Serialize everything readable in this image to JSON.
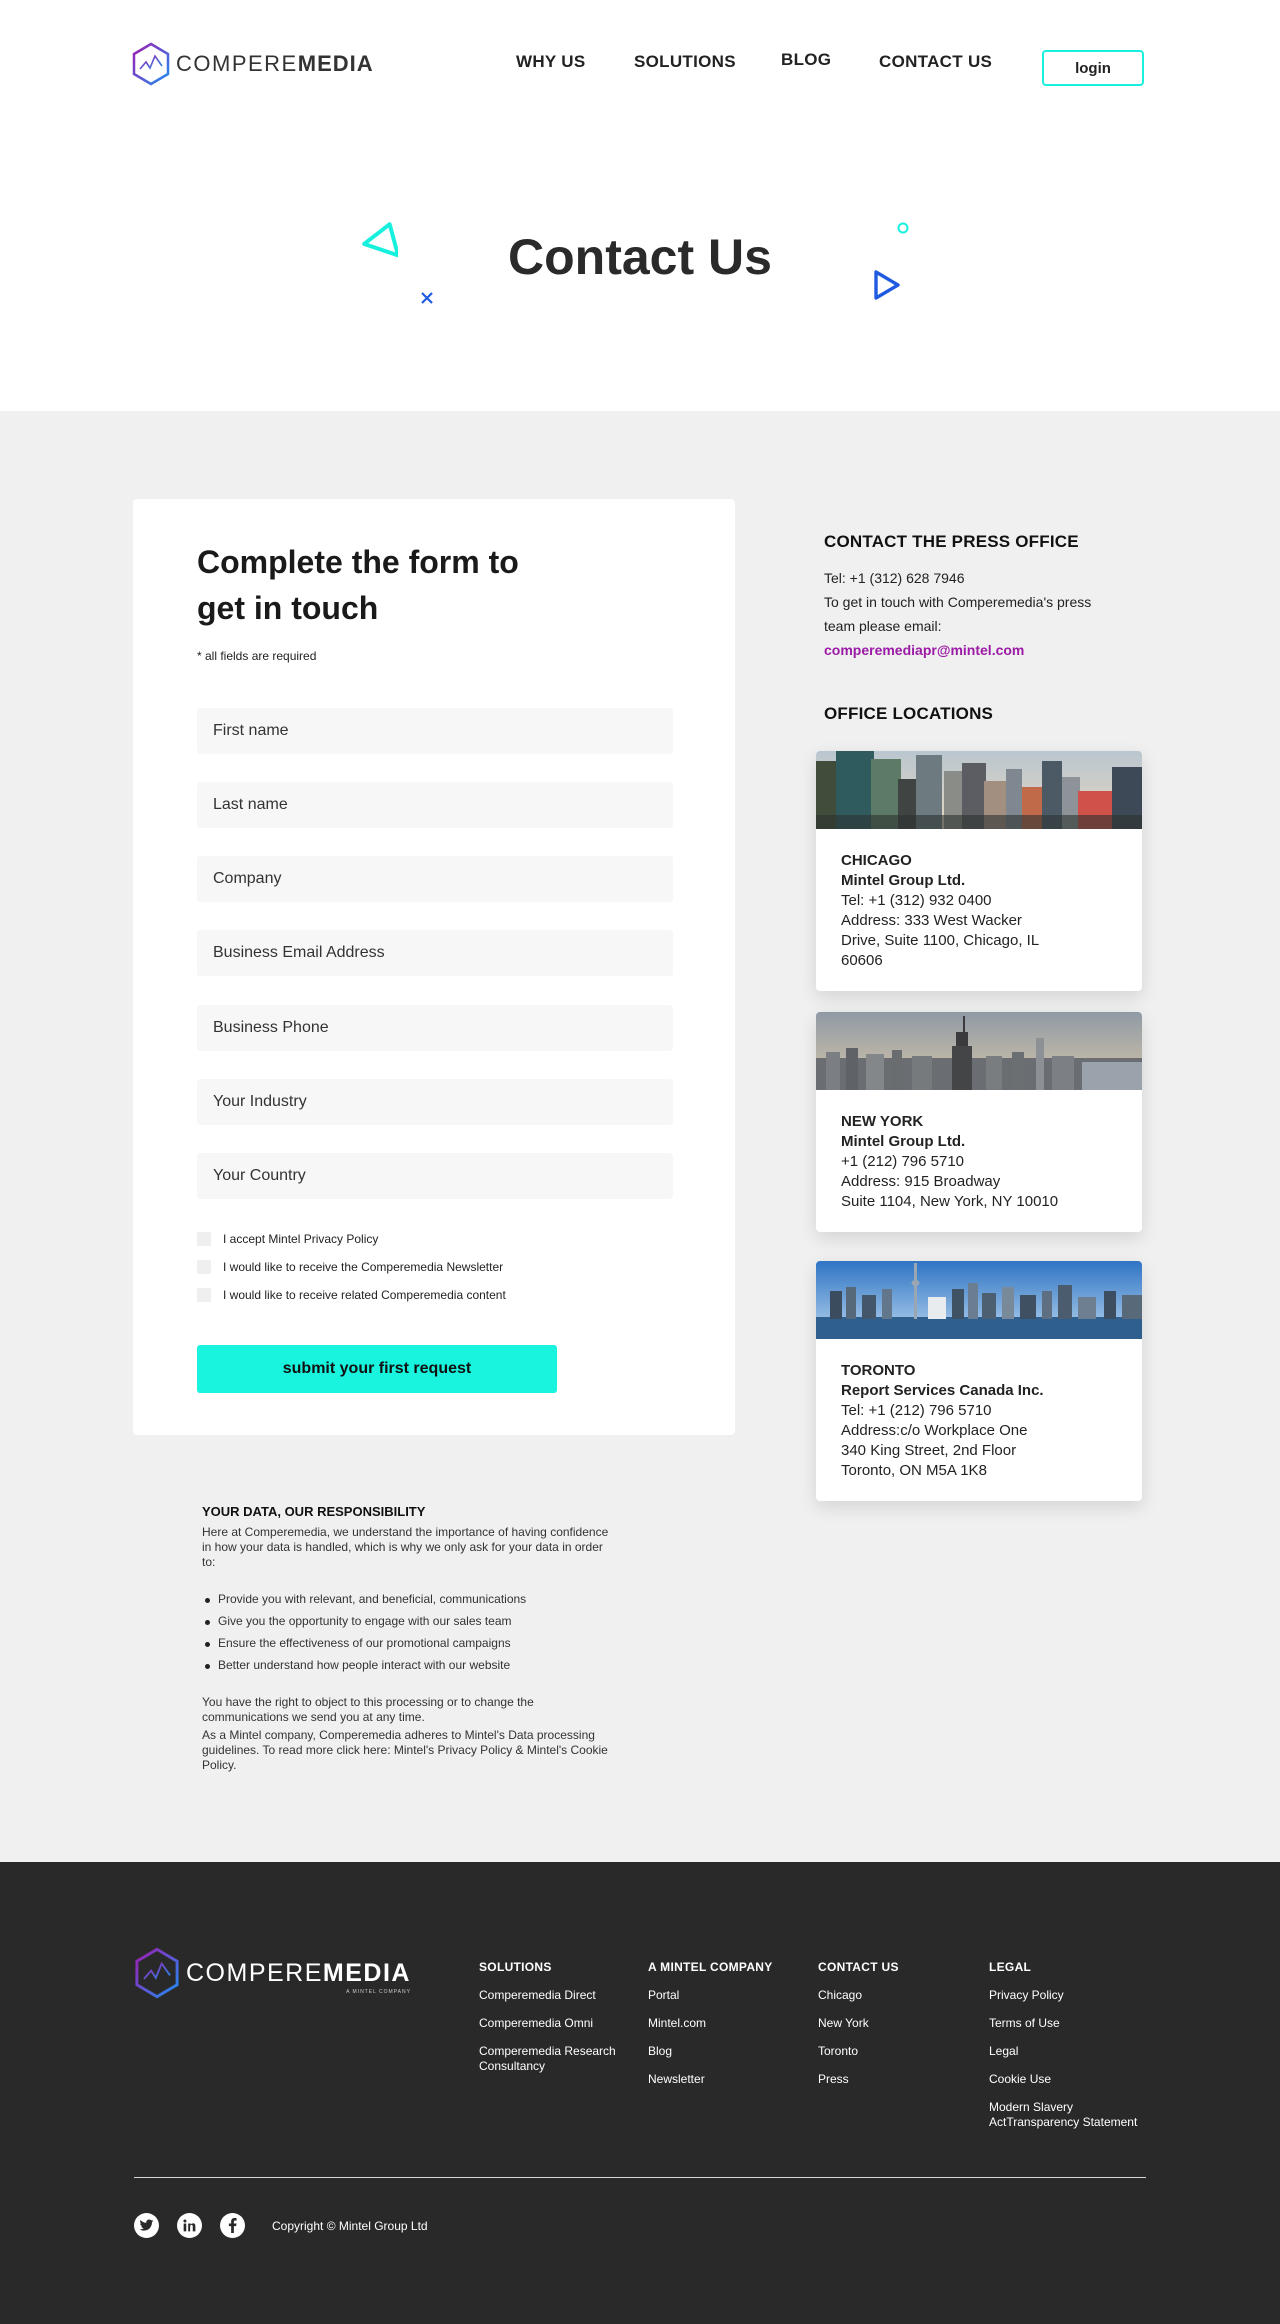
{
  "header": {
    "logo": {
      "word_light": "COMPERE",
      "word_bold": "MEDIA"
    },
    "nav": [
      {
        "label": "WHY US"
      },
      {
        "label": "SOLUTIONS"
      },
      {
        "label": "BLOG"
      },
      {
        "label": "CONTACT US"
      }
    ],
    "login_label": "login"
  },
  "hero": {
    "title": "Contact Us"
  },
  "form": {
    "title": "Complete the form to get in touch",
    "required_note": "* all fields are required",
    "fields": [
      {
        "placeholder": "First name",
        "value": ""
      },
      {
        "placeholder": "Last name",
        "value": ""
      },
      {
        "placeholder": "Company",
        "value": ""
      },
      {
        "placeholder": "Business Email Address",
        "value": ""
      },
      {
        "placeholder": "Business Phone",
        "value": ""
      },
      {
        "placeholder": "Your Industry",
        "value": ""
      },
      {
        "placeholder": "Your Country",
        "value": ""
      }
    ],
    "checkboxes": [
      {
        "label": "I accept Mintel Privacy Policy",
        "checked": false
      },
      {
        "label": "I would like to receive the Comperemedia Newsletter",
        "checked": false
      },
      {
        "label": "I would like to receive related Comperemedia content",
        "checked": false
      }
    ],
    "submit_label": "submit your first request"
  },
  "press": {
    "title": "CONTACT THE PRESS OFFICE",
    "tel": "Tel: +1 (312) 628 7946",
    "text": "To get in touch with Comperemedia's press team please email:",
    "email": "comperemediapr@mintel.com"
  },
  "offices": {
    "title": "OFFICE LOCATIONS",
    "items": [
      {
        "city": "CHICAGO",
        "company": "Mintel Group Ltd.",
        "lines": [
          "Tel: +1 (312) 932 0400",
          "Address: 333 West Wacker",
          "Drive, Suite 1100, Chicago, IL",
          "60606"
        ]
      },
      {
        "city": "NEW YORK",
        "company": "Mintel Group Ltd.",
        "lines": [
          "+1 (212) 796 5710",
          "Address: 915 Broadway",
          "Suite 1104, New York, NY 10010"
        ]
      },
      {
        "city": "TORONTO",
        "company": "Report Services Canada Inc.",
        "lines": [
          "Tel: +1 (212) 796 5710",
          "Address:c/o Workplace One",
          "340 King Street, 2nd Floor",
          "Toronto, ON M5A 1K8"
        ]
      }
    ]
  },
  "privacy": {
    "title": "YOUR DATA, OUR RESPONSIBILITY",
    "intro": "Here at Comperemedia, we understand the importance of having confidence in how your data is handled, which is why we only ask for your data in order to:",
    "bullets": [
      "Provide you with relevant, and beneficial, communications",
      "Give you the opportunity to engage with our sales team",
      "Ensure the effectiveness of our promotional campaigns",
      "Better understand how people interact with our website"
    ],
    "rights": "You have the right to object to this processing or to change the communications we send you at any time.",
    "mintel": "As a Mintel company, Comperemedia adheres to Mintel's Data processing guidelines. To read more click here: Mintel's Privacy Policy & Mintel's Cookie Policy."
  },
  "footer": {
    "logo": {
      "word_light": "COMPERE",
      "word_bold": "MEDIA",
      "sub": "A MINTEL COMPANY"
    },
    "columns": [
      {
        "title": "SOLUTIONS",
        "links": [
          "Comperemedia Direct",
          "Comperemedia Omni",
          "Comperemedia Research Consultancy"
        ]
      },
      {
        "title": "A MINTEL COMPANY",
        "links": [
          "Portal",
          "Mintel.com",
          "Blog",
          "Newsletter"
        ]
      },
      {
        "title": "CONTACT US",
        "links": [
          "Chicago",
          "New York",
          "Toronto",
          "Press"
        ]
      },
      {
        "title": "LEGAL",
        "links": [
          "Privacy Policy",
          "Terms of Use",
          "Legal",
          "Cookie Use",
          "Modern Slavery ActTransparency Statement"
        ]
      }
    ],
    "social": [
      "twitter-icon",
      "linkedin-icon",
      "facebook-icon"
    ],
    "copyright": "Copyright © Mintel Group Ltd"
  },
  "colors": {
    "accent": "#18f4de",
    "email": "#9b1aa6",
    "footer_bg": "#292929",
    "main_bg": "#f0f0f0",
    "deco_blue": "#1f5ae0"
  }
}
